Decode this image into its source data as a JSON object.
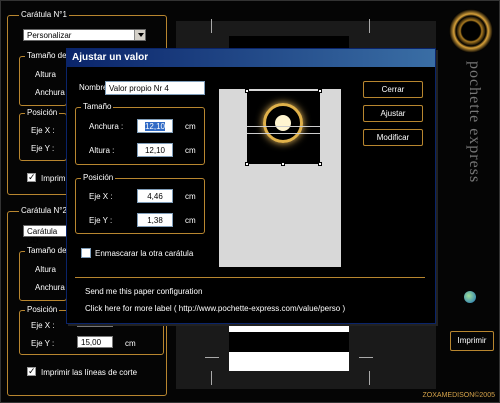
{
  "background": {
    "section1_legend": "Carátula N°1",
    "combo1_value": "Personalizar",
    "size1_legend": "Tamaño de",
    "alt1_label": "Altura",
    "anch1_label": "Anchura",
    "pos1_legend": "Posición",
    "ejex1_label": "Eje X :",
    "ejey1_label": "Eje Y :",
    "print1_label": "Imprimir",
    "section2_legend": "Carátula N°2",
    "combo2_value": "Carátula CD",
    "size2_legend": "Tamaño de",
    "alt2_label": "Altura",
    "anch2_label": "Anchura",
    "pos2_legend": "Posición",
    "ejex2_label": "Eje X :",
    "ejex2_value": "",
    "ejey2_label": "Eje Y :",
    "ejey2_value": "15,00",
    "ejey2_unit": "cm",
    "print2_label": "Imprimir las líneas de corte",
    "print_button": "Imprimir",
    "brand_text": "pochette express",
    "copyright": "ZOXAMEDISON©2005"
  },
  "dialog": {
    "title": "Ajustar un valor",
    "name_label": "Nombre",
    "name_value": "Valor propio Nr 4",
    "size_legend": "Tamaño",
    "width_label": "Anchura :",
    "width_value": "12,10",
    "width_unit": "cm",
    "height_label": "Altura :",
    "height_value": "12,10",
    "height_unit": "cm",
    "pos_legend": "Posición",
    "x_label": "Eje X :",
    "x_value": "4,46",
    "x_unit": "cm",
    "y_label": "Eje Y :",
    "y_value": "1,38",
    "y_unit": "cm",
    "mask_label": "Enmascarar la otra carátula",
    "close_button": "Cerrar",
    "adjust_button": "Ajustar",
    "modify_button": "Modificar",
    "send_link": "Send me this paper configuration",
    "more_link": "Click here for more label ( http://www.pochette-express.com/value/perso )"
  },
  "colors": {
    "accent": "#b8862f",
    "title_bar": "#0a246a",
    "selection": "#316ac5"
  }
}
